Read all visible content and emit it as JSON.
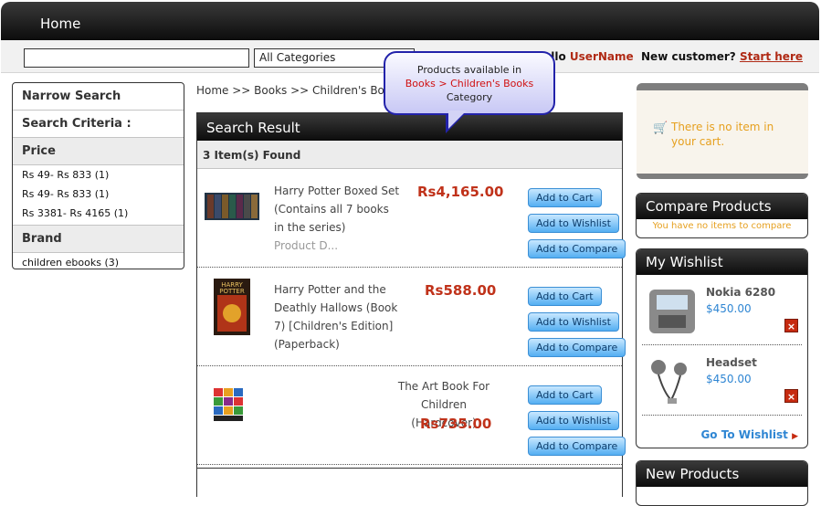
{
  "nav": {
    "home": "Home"
  },
  "search": {
    "query": "",
    "category": "All Categories"
  },
  "greeting": {
    "hello": "Hello",
    "username": "UserName",
    "new_customer": "New customer?",
    "start_here": "Start here"
  },
  "narrow": {
    "title": "Narrow Search",
    "criteria": "Search Criteria :",
    "price_label": "Price",
    "prices": [
      "Rs 49- Rs 833 (1)",
      "Rs 49- Rs 833 (1)",
      "Rs 3381- Rs 4165 (1)"
    ],
    "brand_label": "Brand",
    "brands": [
      "children ebooks (3)"
    ]
  },
  "breadcrumb": "Home >> Books >> Children's Books",
  "callout": {
    "line1": "Products available in",
    "line2": "Books > Children's Books",
    "line3": "Category"
  },
  "results": {
    "title": "Search Result",
    "count": "3 Item(s) Found",
    "products": [
      {
        "name": "Harry Potter Boxed Set (Contains all 7 books in the series)",
        "more": "Product D...",
        "price": "Rs4,165.00"
      },
      {
        "name": "Harry Potter and the Deathly Hallows (Book 7) [Children's Edition] (Paperback)",
        "more": "",
        "price": "Rs588.00"
      },
      {
        "name": "The Art Book For Children (Hardcover)",
        "more": "",
        "price": "Rs735.00"
      }
    ],
    "buttons": {
      "cart": "Add to Cart",
      "wishlist": "Add to Wishlist",
      "compare": "Add to Compare"
    }
  },
  "cart": {
    "empty": "There is no item in your cart."
  },
  "compare": {
    "title": "Compare Products",
    "empty": "You have no items to compare"
  },
  "wishlist": {
    "title": "My Wishlist",
    "items": [
      {
        "name": "Nokia 6280",
        "price": "$450.00"
      },
      {
        "name": "Headset",
        "price": "$450.00"
      }
    ],
    "goto": "Go To Wishlist"
  },
  "new_products": {
    "title": "New Products"
  },
  "colors": {
    "accent_red": "#c0321a",
    "link_blue": "#2f86d3",
    "notice_orange": "#e6a01f"
  }
}
